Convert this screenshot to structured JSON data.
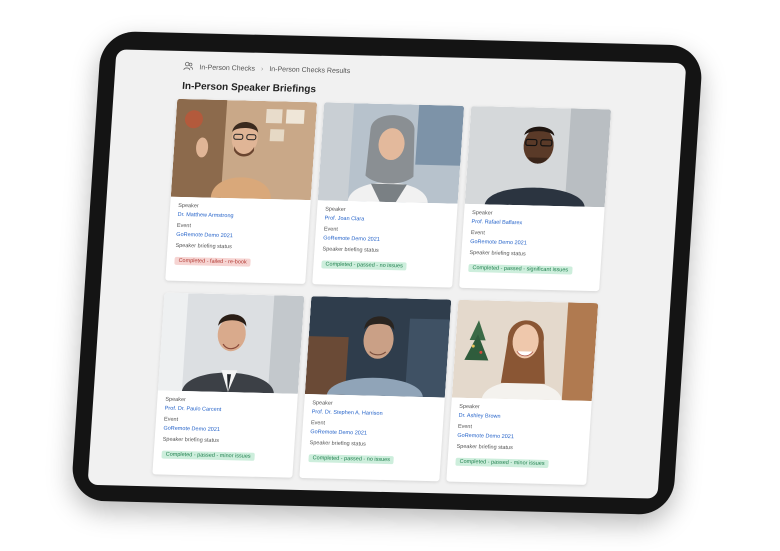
{
  "breadcrumb": {
    "icon": "users-icon",
    "items": [
      "In-Person Checks",
      "In-Person Checks Results"
    ]
  },
  "page": {
    "title": "In-Person Speaker Briefings"
  },
  "cards": [
    {
      "speaker_label": "Speaker",
      "speaker": "Dr. Matthew Armstrong",
      "event_label": "Event",
      "event": "GoRemote Demo 2021",
      "status_label": "Speaker briefing status",
      "status": "Completed - failed - re-book",
      "status_color": "red"
    },
    {
      "speaker_label": "Speaker",
      "speaker": "Prof. Joan Clara",
      "event_label": "Event",
      "event": "GoRemote Demo 2021",
      "status_label": "Speaker briefing status",
      "status": "Completed - passed - no issues",
      "status_color": "green"
    },
    {
      "speaker_label": "Speaker",
      "speaker": "Prof. Rafael Baflarex",
      "event_label": "Event",
      "event": "GoRemote Demo 2021",
      "status_label": "Speaker briefing status",
      "status": "Completed - passed - significant issues",
      "status_color": "green"
    },
    {
      "speaker_label": "Speaker",
      "speaker": "Prof. Dr. Paulo Carcent",
      "event_label": "Event",
      "event": "GoRemote Demo 2021",
      "status_label": "Speaker briefing status",
      "status": "Completed - passed - minor issues",
      "status_color": "green"
    },
    {
      "speaker_label": "Speaker",
      "speaker": "Prof. Dr. Stephen A. Harrison",
      "event_label": "Event",
      "event": "GoRemote Demo 2021",
      "status_label": "Speaker briefing status",
      "status": "Completed - passed - no issues",
      "status_color": "green"
    },
    {
      "speaker_label": "Speaker",
      "speaker": "Dr. Ashley Brown",
      "event_label": "Event",
      "event": "GoRemote Demo 2021",
      "status_label": "Speaker briefing status",
      "status": "Completed - passed - minor issues",
      "status_color": "green"
    }
  ]
}
